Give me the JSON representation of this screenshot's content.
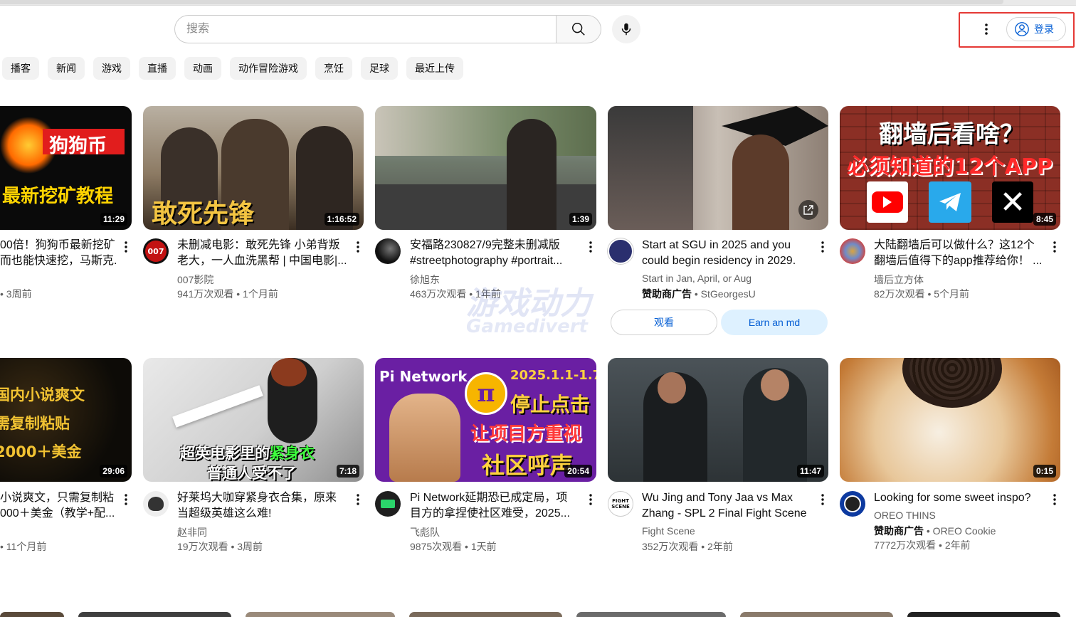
{
  "header": {
    "search_placeholder": "搜索",
    "signin_label": "登录"
  },
  "chips": [
    "播客",
    "新闻",
    "游戏",
    "直播",
    "动画",
    "动作冒险游戏",
    "烹饪",
    "足球",
    "最近上传"
  ],
  "watermark": {
    "line1": "游戏动力",
    "line2": "Gamedivert"
  },
  "videos": [
    {
      "thumb_text1": "狗狗币",
      "thumb_text2": "最新挖矿教程",
      "duration": "11:29",
      "title1": "00倍！狗狗币最新挖矿",
      "title2": "而也能快速挖，马斯克...",
      "channel": "",
      "stats": "• 3周前"
    },
    {
      "thumb_text1": "敢死先锋",
      "duration": "1:16:52",
      "avatar_text": "007",
      "title1": "未删减电影：敢死先锋 小弟背叛",
      "title2": "老大，一人血洗黑帮 | 中国电影|...",
      "channel": "007影院",
      "stats": "941万次观看 • 1个月前"
    },
    {
      "duration": "1:39",
      "title1": "安福路230827/9完整未删减版",
      "title2": "#streetphotography #portrait...",
      "channel": "徐旭东",
      "stats": "463万次观看 • 1年前"
    },
    {
      "duration": "",
      "title1": "Start at SGU in 2025 and you",
      "title2": "could begin residency in 2029.",
      "channel": "Start in Jan, April, or Aug",
      "sponsor_label": "赞助商广告",
      "sponsor_name": " • StGeorgesU",
      "btn_watch": "观看",
      "btn_earn": "Earn an md"
    },
    {
      "thumb_text1": "翻墙后看啥？",
      "thumb_text2": "必须知道的12个APP",
      "duration": "8:45",
      "title1": "大陆翻墙后可以做什么？这12个",
      "title2": "翻墙后值得下的app推荐给你！ ...",
      "channel": "墙后立方体",
      "stats": "82万次观看 • 5个月前"
    },
    {
      "thumb_text1": "国内小说爽文",
      "thumb_text2": "需复制粘贴",
      "thumb_text3": "2000＋美金",
      "duration": "29:06",
      "title1": "小说爽文，只需复制粘",
      "title2": "000＋美金（教学+配...",
      "channel": "",
      "stats": "• 11个月前"
    },
    {
      "thumb_text1": "超英电影里的",
      "thumb_text1b": "紧身衣",
      "thumb_text2": "普通人受不了",
      "duration": "7:18",
      "title1": "好莱坞大咖穿紧身衣合集，原来",
      "title2": "当超级英雄这么难!",
      "channel": "赵非同",
      "stats": "19万次观看 • 3周前"
    },
    {
      "thumb_text1": "Pi Network",
      "thumb_text2": "2025.1.1-1.7",
      "thumb_text3": "停止点击",
      "thumb_text4": "让项目方重视",
      "thumb_text5": "社区呼声",
      "duration": "20:54",
      "title1": "Pi Network延期恐已成定局，项",
      "title2": "目方的拿捏使社区难受，2025...",
      "channel": "飞彪队",
      "stats": "9875次观看 • 1天前"
    },
    {
      "duration": "11:47",
      "avatar_text": "FIGHT SCENE",
      "title1": "Wu Jing and Tony Jaa vs Max",
      "title2": "Zhang - SPL 2 Final Fight Scene",
      "channel": "Fight Scene",
      "stats": "352万次观看 • 2年前"
    },
    {
      "duration": "0:15",
      "title1": "Looking for some sweet inspo?",
      "channel": "OREO THINS",
      "sponsor_label": "赞助商广告",
      "sponsor_name": " • OREO Cookie",
      "stats": "7772万次观看 • 2年前"
    }
  ],
  "colors": {
    "accent": "#065fd4",
    "highlight": "#e53935"
  }
}
